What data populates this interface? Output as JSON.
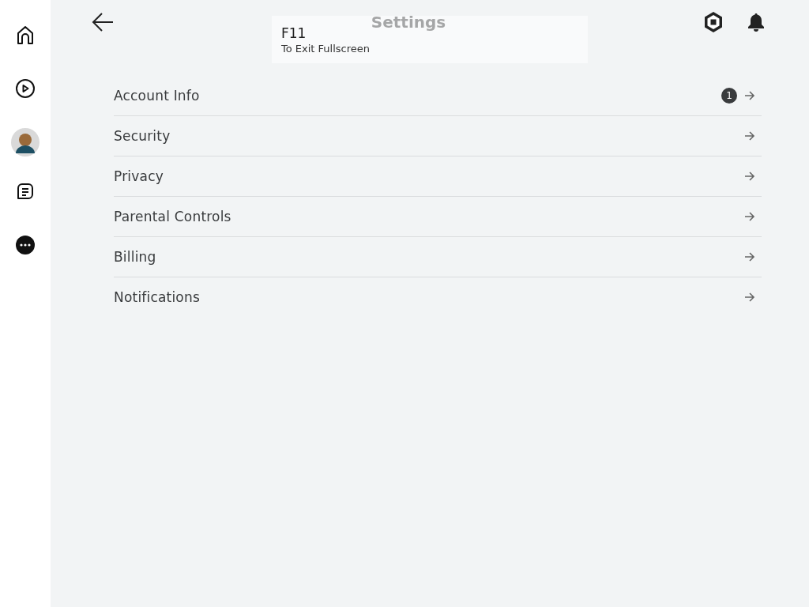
{
  "header": {
    "title": "Settings"
  },
  "fullscreen_toast": {
    "key": "F11",
    "message": "To Exit Fullscreen"
  },
  "settings_items": [
    {
      "label": "Account Info",
      "badge": "1"
    },
    {
      "label": "Security"
    },
    {
      "label": "Privacy"
    },
    {
      "label": "Parental Controls"
    },
    {
      "label": "Billing"
    },
    {
      "label": "Notifications"
    }
  ]
}
